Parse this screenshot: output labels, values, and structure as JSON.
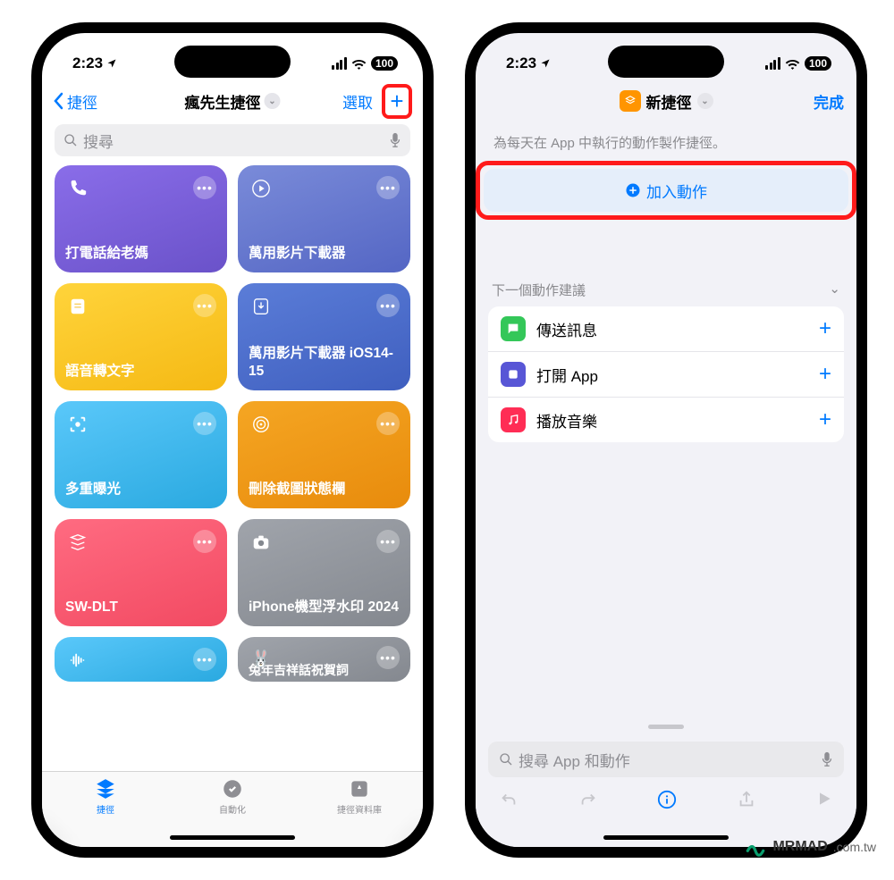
{
  "status": {
    "time": "2:23",
    "battery": "100"
  },
  "left": {
    "back": "捷徑",
    "title": "瘋先生捷徑",
    "select": "選取",
    "search_placeholder": "搜尋",
    "tiles": [
      {
        "label": "打電話給老媽",
        "color": "linear-gradient(160deg,#8a6de9,#6a52c9)"
      },
      {
        "label": "萬用影片下載器",
        "color": "linear-gradient(160deg,#7a8bd9,#5466c4)"
      },
      {
        "label": "語音轉文字",
        "color": "linear-gradient(160deg,#ffd43b,#f5b914)"
      },
      {
        "label": "萬用影片下載器 iOS14-15",
        "color": "linear-gradient(160deg,#5b7dd8,#3f5fbf)"
      },
      {
        "label": "多重曝光",
        "color": "linear-gradient(160deg,#5ac8fa,#2aa9e0)"
      },
      {
        "label": "刪除截圖狀態欄",
        "color": "linear-gradient(160deg,#f5a623,#e88b0c)"
      },
      {
        "label": "SW-DLT",
        "color": "linear-gradient(160deg,#ff6b81,#f24a62)"
      },
      {
        "label": "iPhone機型浮水印 2024",
        "color": "linear-gradient(160deg,#a0a4ab,#84888f)"
      },
      {
        "label": "",
        "color": "linear-gradient(160deg,#5ac8fa,#2aa9e0)"
      },
      {
        "label": "兔年吉祥話祝賀詞",
        "color": "linear-gradient(160deg,#a0a4ab,#84888f)"
      }
    ],
    "tabs": {
      "shortcuts": "捷徑",
      "automation": "自動化",
      "gallery": "捷徑資料庫"
    }
  },
  "right": {
    "title": "新捷徑",
    "done": "完成",
    "hint": "為每天在 App 中執行的動作製作捷徑。",
    "add_action": "加入動作",
    "suggestions_header": "下一個動作建議",
    "suggestions": [
      {
        "label": "傳送訊息",
        "color": "green"
      },
      {
        "label": "打開 App",
        "color": "purple"
      },
      {
        "label": "播放音樂",
        "color": "red"
      }
    ],
    "search_placeholder": "搜尋 App 和動作"
  },
  "watermark": {
    "brand": "MRMAD",
    "tld": ".com.tw"
  }
}
